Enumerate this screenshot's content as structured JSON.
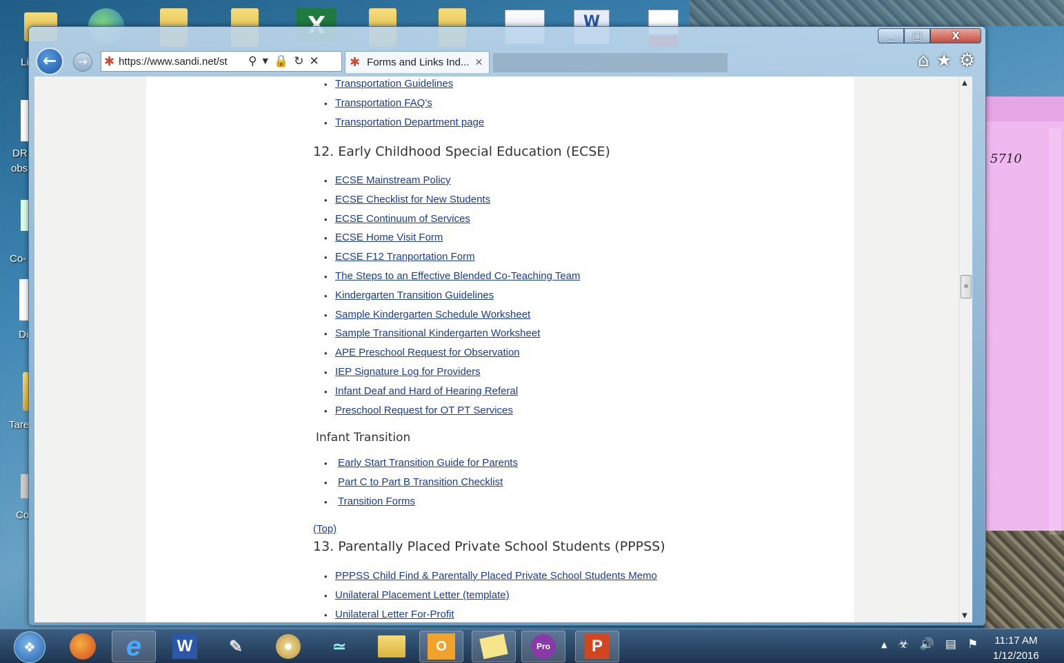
{
  "desktop": {
    "labels": [
      "Li",
      "DR",
      "obs",
      "Co-",
      "Di",
      "Tare",
      "Co"
    ],
    "sticky_note_text": "5710"
  },
  "browser": {
    "url": "https://www.sandi.net/st",
    "tab_title": "Forms and Links Ind...",
    "window_buttons": {
      "minimize": "_",
      "maximize": "□",
      "close": "X"
    }
  },
  "page": {
    "section_top_links": [
      "Transportation Guidelines",
      "Transportation FAQ's",
      "Transportation Department page"
    ],
    "section12_title": "12.   Early Childhood Special Education  (ECSE)",
    "section12_links": [
      "ECSE  Mainstream Policy",
      "ECSE Checklist for New Students",
      "ECSE Continuum of Services",
      "ECSE Home Visit Form",
      "ECSE F12 Tranportation Form",
      "The Steps to an Effective Blended Co-Teaching Team",
      "Kindergarten Transition Guidelines",
      "Sample Kindergarten Schedule Worksheet",
      "Sample Transitional Kindergarten Worksheet",
      "APE Preschool Request for Observation",
      "IEP Signature Log for Providers",
      "Infant Deaf and Hard of Hearing Referal",
      "Preschool Request for OT PT Services"
    ],
    "infant_heading": "Infant Transition",
    "infant_links": [
      "Early Start Transition Guide for Parents",
      "Part C to Part B Transition Checklist",
      "Transition Forms"
    ],
    "top_link": "(Top)",
    "section13_title": "13. Parentally Placed Private School Students  (PPPSS)",
    "section13_links": [
      "PPPSS Child Find & Parentally Placed Private School Students Memo",
      "Unilateral Placement Letter (template)",
      "Unilateral Letter For-Profit"
    ]
  },
  "taskbar": {
    "apps": [
      "firefox-icon",
      "ie-icon",
      "word-icon",
      "tool-icon",
      "media-icon",
      "network-icon",
      "explorer-icon",
      "outlook-icon",
      "notes-icon",
      "pdf-pro-icon",
      "powerpoint-icon"
    ],
    "time": "11:17 AM",
    "date": "1/12/2016"
  }
}
